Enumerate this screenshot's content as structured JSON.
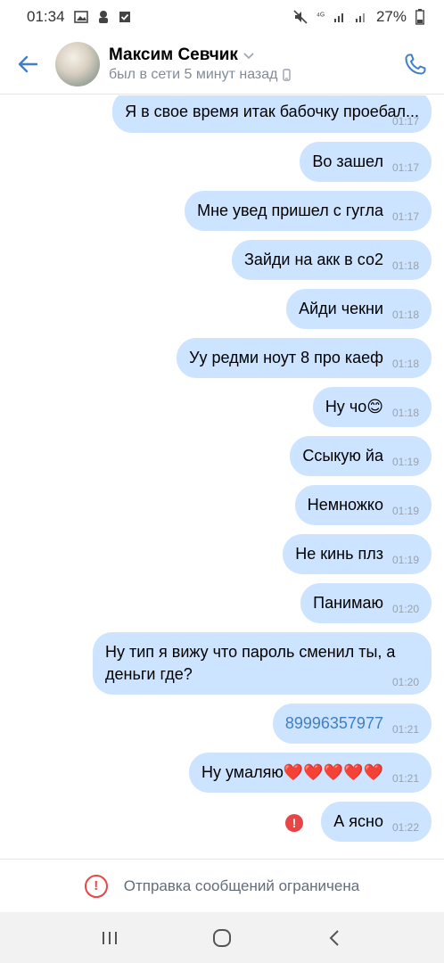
{
  "status_bar": {
    "time": "01:34",
    "battery": "27%"
  },
  "header": {
    "contact_name": "Максим Севчик",
    "last_seen": "был в сети 5 минут назад"
  },
  "messages": [
    {
      "text": "Я в свое время итак бабочку проебал...",
      "time": "01:17"
    },
    {
      "text": "Во зашел",
      "time": "01:17"
    },
    {
      "text": "Мне увед пришел с гугла",
      "time": "01:17"
    },
    {
      "text": "Зайди на акк в со2",
      "time": "01:18"
    },
    {
      "text": "Айди чекни",
      "time": "01:18"
    },
    {
      "text": "Уу редми ноут 8 про каеф",
      "time": "01:18"
    },
    {
      "text": "Ну чо😊",
      "time": "01:18"
    },
    {
      "text": "Ссыкую йа",
      "time": "01:19"
    },
    {
      "text": "Немножко",
      "time": "01:19"
    },
    {
      "text": "Не кинь плз",
      "time": "01:19"
    },
    {
      "text": "Панимаю",
      "time": "01:20"
    },
    {
      "text": "Ну тип я вижу что пароль сменил ты, а деньги где?",
      "time": "01:20"
    },
    {
      "text": "89996357977",
      "time": "01:21"
    },
    {
      "text": "Ну умаляю❤️❤️❤️❤️❤️",
      "time": "01:21"
    },
    {
      "text": "А ясно",
      "time": "01:22"
    }
  ],
  "restricted_banner": {
    "text": "Отправка сообщений ограничена"
  },
  "colors": {
    "bubble": "#cce4ff",
    "accent": "#3f7fc4",
    "error": "#e64646"
  }
}
